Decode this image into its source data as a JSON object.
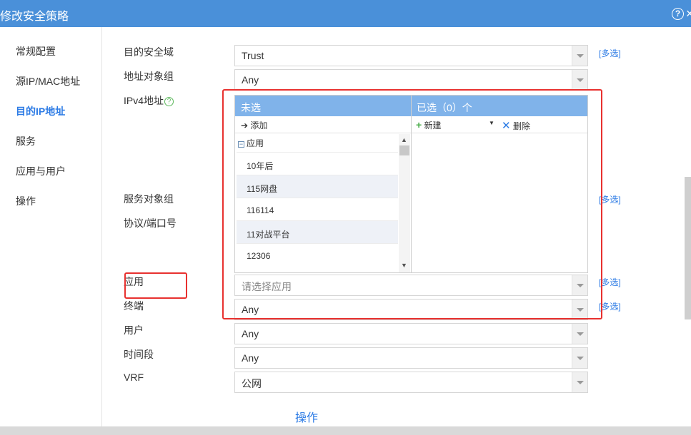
{
  "window": {
    "title": "修改安全策略",
    "help_icon": "?",
    "close_icon": "close-icon"
  },
  "sidebar": {
    "items": [
      {
        "label": "常规配置",
        "active": false
      },
      {
        "label": "源IP/MAC地址",
        "active": false
      },
      {
        "label": "目的IP地址",
        "active": true
      },
      {
        "label": "服务",
        "active": false
      },
      {
        "label": "应用与用户",
        "active": false
      },
      {
        "label": "操作",
        "active": false
      }
    ]
  },
  "form": {
    "dest_zone": {
      "label": "目的安全域",
      "value": "Trust",
      "multi": "[多选]"
    },
    "addr_group": {
      "label": "地址对象组",
      "value": "Any"
    },
    "ipv4": {
      "label": "IPv4地址",
      "help": "?"
    },
    "service_group": {
      "label": "服务对象组",
      "multi": "[多选]"
    },
    "protocol_port": {
      "label": "协议/端口号"
    },
    "application": {
      "label": "应用",
      "placeholder": "请选择应用",
      "multi": "[多选]"
    },
    "terminal": {
      "label": "终端",
      "value": "Any",
      "multi": "[多选]"
    },
    "user": {
      "label": "用户",
      "value": "Any"
    },
    "time_range": {
      "label": "时间段",
      "value": "Any"
    },
    "vrf": {
      "label": "VRF",
      "value": "公网"
    }
  },
  "picker": {
    "unselected_title": "未选",
    "selected_title": "已选（0）个",
    "add_label": "添加",
    "new_label": "新建",
    "delete_label": "删除",
    "group_label": "应用",
    "items": [
      "10年后",
      "115网盘",
      "116114",
      "11对战平台",
      "12306"
    ]
  },
  "footer": {
    "ops_label": "操作"
  },
  "colors": {
    "titlebar": "#4a90d9",
    "accent": "#2c7be5",
    "picker_header": "#80b3ea",
    "highlight_red": "#e8312f"
  }
}
